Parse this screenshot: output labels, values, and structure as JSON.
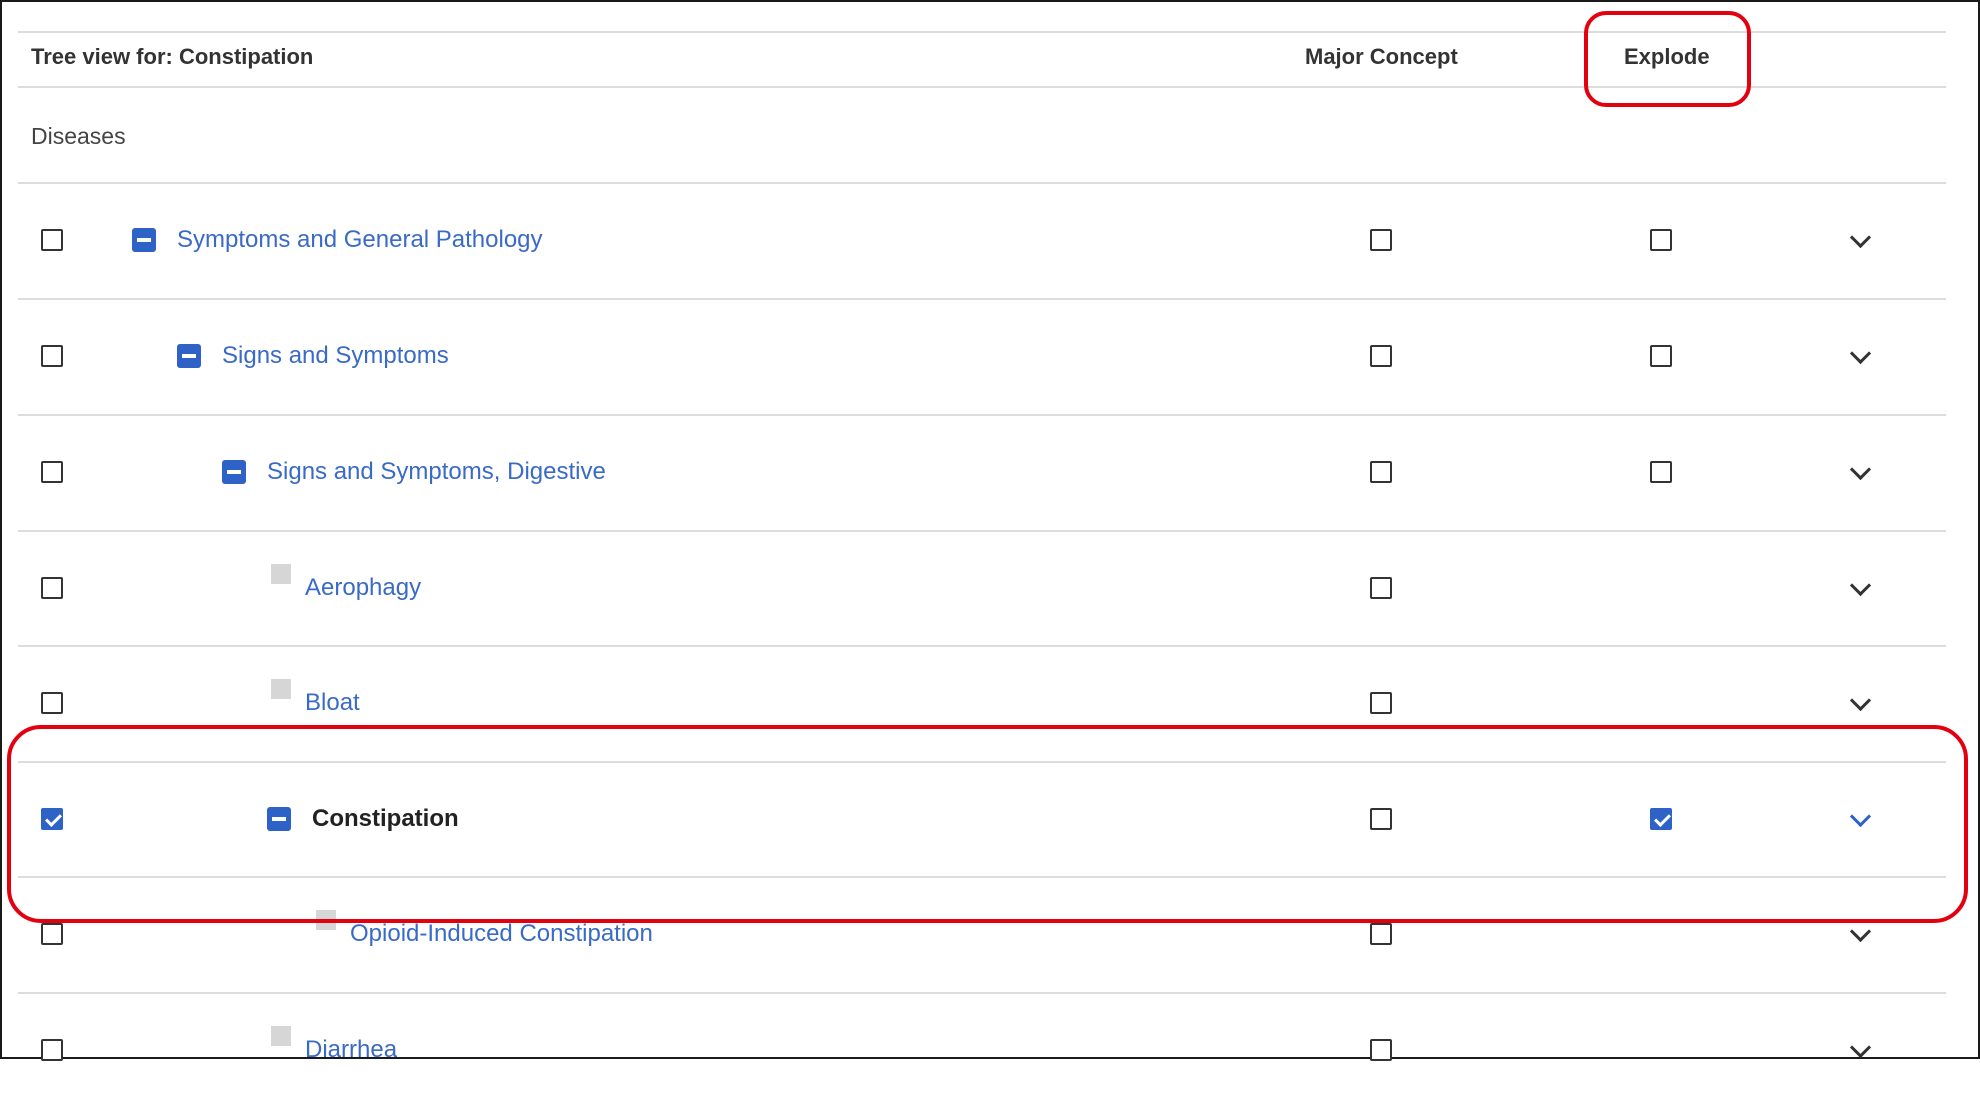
{
  "header": {
    "tree_view_label": "Tree view for: Constipation",
    "major_concept_label": "Major Concept",
    "explode_label": "Explode"
  },
  "section_label": "Diseases",
  "rows": [
    {
      "label": "Symptoms and General Pathology",
      "level": 0,
      "node": "expanded",
      "selected": false,
      "major": false,
      "explode": false,
      "has_explode": true
    },
    {
      "label": "Signs and Symptoms",
      "level": 1,
      "node": "expanded",
      "selected": false,
      "major": false,
      "explode": false,
      "has_explode": true
    },
    {
      "label": "Signs and Symptoms, Digestive",
      "level": 2,
      "node": "expanded",
      "selected": false,
      "major": false,
      "explode": false,
      "has_explode": true
    },
    {
      "label": "Aerophagy",
      "level": 3,
      "node": "leaf",
      "selected": false,
      "major": false,
      "explode": false,
      "has_explode": false
    },
    {
      "label": "Bloat",
      "level": 3,
      "node": "leaf",
      "selected": false,
      "major": false,
      "explode": false,
      "has_explode": false
    },
    {
      "label": "Constipation",
      "level": 3,
      "node": "expanded",
      "selected": true,
      "major": false,
      "explode": true,
      "has_explode": true,
      "current": true
    },
    {
      "label": "Opioid-Induced Constipation",
      "level": 4,
      "node": "leaf",
      "selected": false,
      "major": false,
      "explode": false,
      "has_explode": false
    },
    {
      "label": "Diarrhea",
      "level": 3,
      "node": "leaf",
      "selected": false,
      "major": false,
      "explode": false,
      "has_explode": false
    }
  ],
  "colors": {
    "link": "#3a6ac8",
    "accent": "#2f62c7",
    "highlight": "#e3000f"
  }
}
